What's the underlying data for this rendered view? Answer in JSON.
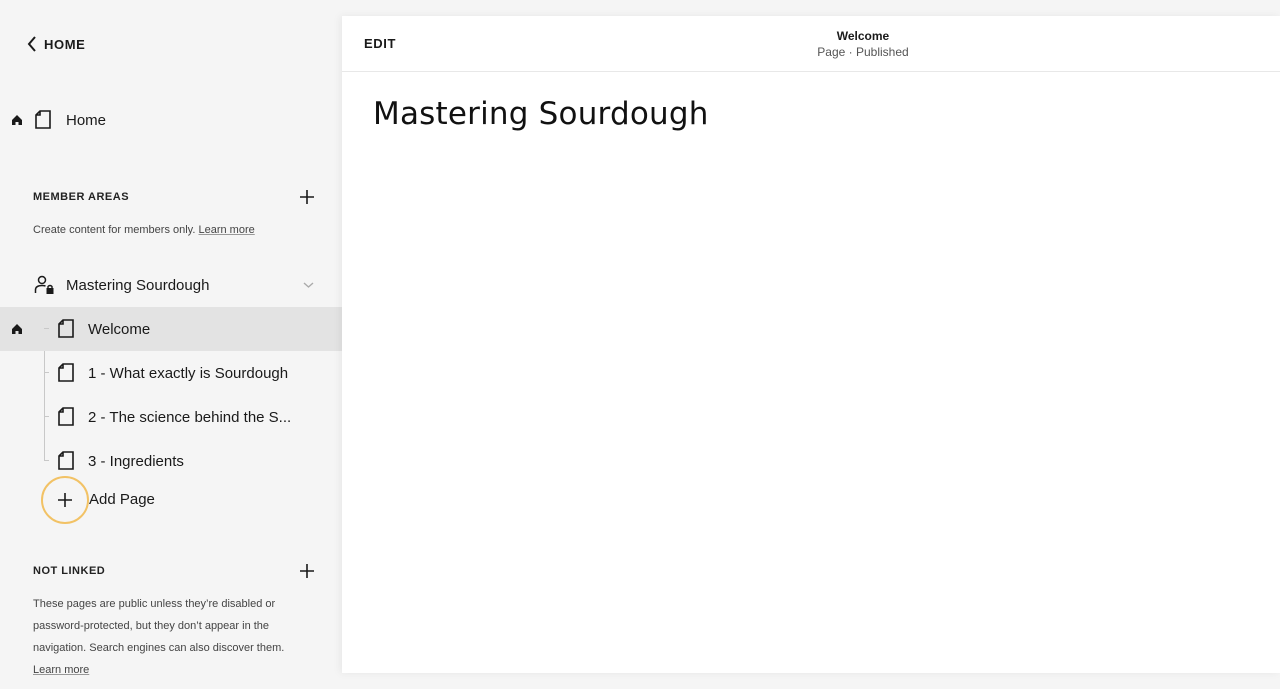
{
  "sidebar": {
    "back_label": "HOME",
    "home_page": {
      "label": "Home"
    },
    "member_areas": {
      "title": "MEMBER AREAS",
      "description": "Create content for members only.",
      "learn_more": "Learn more",
      "area": {
        "label": "Mastering Sourdough",
        "pages": [
          {
            "label": "Welcome"
          },
          {
            "label": "1 - What exactly is Sourdough"
          },
          {
            "label": "2 - The science behind the S..."
          },
          {
            "label": "3 - Ingredients"
          }
        ],
        "add_page": "Add Page"
      }
    },
    "not_linked": {
      "title": "NOT LINKED",
      "description_lines": [
        "These pages are public unless they’re disabled or",
        "password-protected, but they don’t appear in the",
        "navigation. Search engines can also discover them."
      ],
      "learn_more": "Learn more"
    }
  },
  "editor": {
    "edit_label": "EDIT",
    "page_title": "Welcome",
    "page_status": "Page · Published",
    "content_heading": "Mastering Sourdough"
  },
  "colors": {
    "sidebar_bg": "#f5f5f5",
    "selected_row": "#e3e3e3",
    "highlight_ring": "#f2c265"
  }
}
